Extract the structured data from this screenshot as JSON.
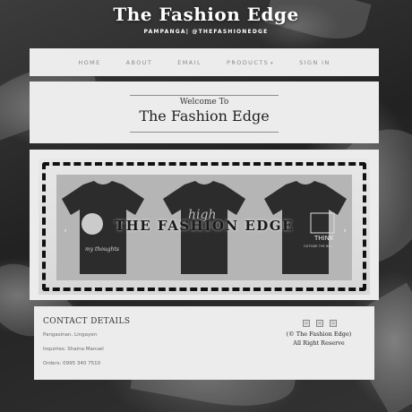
{
  "header": {
    "title": "The Fashion Edge",
    "tagline": "PAMPANGA| @THEFASHIONEDGE"
  },
  "nav": {
    "items": [
      {
        "label": "HOME"
      },
      {
        "label": "ABOUT"
      },
      {
        "label": "EMAIL"
      },
      {
        "label": "PRODUCTS"
      },
      {
        "label": "SIGN IN"
      }
    ]
  },
  "welcome": {
    "line1": "Welcome To",
    "line2": "The Fashion Edge"
  },
  "slider": {
    "caption": "THE FASHION EDGE",
    "shirt1_text": "my thoughts",
    "shirt2_text": "high",
    "shirt3_text": "THINK",
    "shirt3_sub": "OUTSIDE THE BOX"
  },
  "footer": {
    "heading": "CONTACT DETAILS",
    "address": "Pangasinan, Lingayen",
    "inquiries": "Inquiries: Shaina Manuel",
    "orders": "Orders: 0995 340 7510",
    "copyright_line1": "(© The Fashion Edge)",
    "copyright_line2": "All Right Reserve"
  }
}
